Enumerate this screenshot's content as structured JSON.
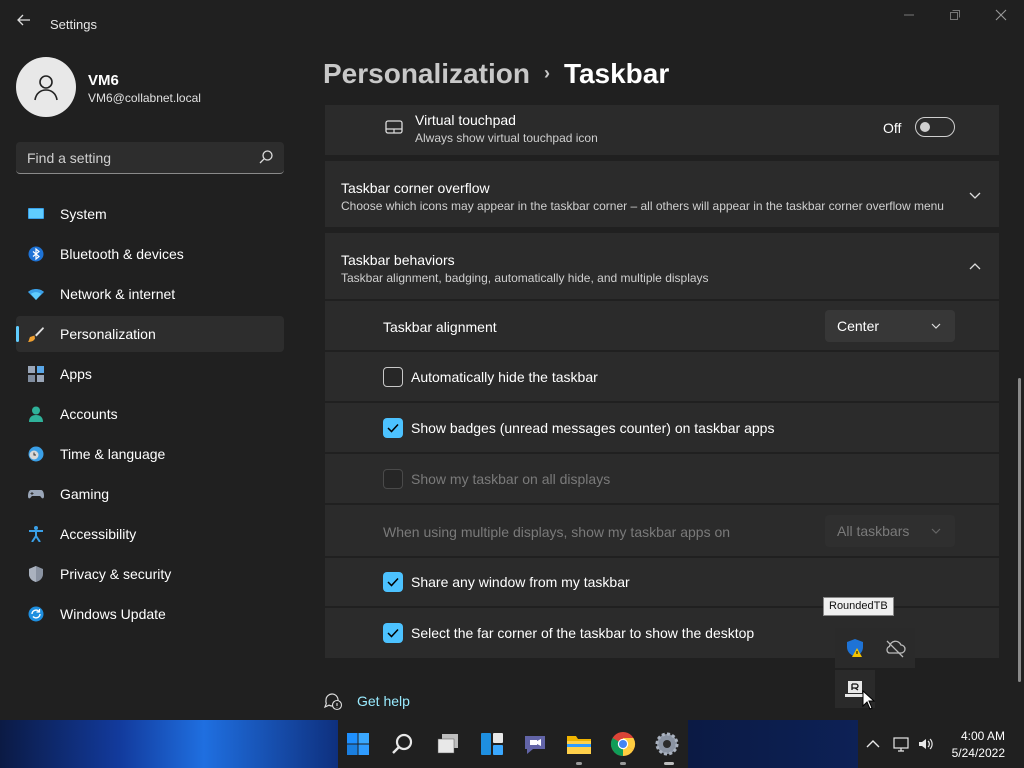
{
  "window": {
    "title": "Settings",
    "back_icon": "back-arrow-icon",
    "controls": [
      "minimize-icon",
      "maximize-icon",
      "close-icon"
    ]
  },
  "user": {
    "name": "VM6",
    "email": "VM6@collabnet.local"
  },
  "search": {
    "placeholder": "Find a setting",
    "value": ""
  },
  "sidebar": {
    "items": [
      {
        "label": "System",
        "icon": "monitor-icon"
      },
      {
        "label": "Bluetooth & devices",
        "icon": "bluetooth-icon"
      },
      {
        "label": "Network & internet",
        "icon": "wifi-icon"
      },
      {
        "label": "Personalization",
        "icon": "paintbrush-icon",
        "selected": true
      },
      {
        "label": "Apps",
        "icon": "apps-icon"
      },
      {
        "label": "Accounts",
        "icon": "person-icon"
      },
      {
        "label": "Time & language",
        "icon": "clock-globe-icon"
      },
      {
        "label": "Gaming",
        "icon": "gamepad-icon"
      },
      {
        "label": "Accessibility",
        "icon": "accessibility-icon"
      },
      {
        "label": "Privacy & security",
        "icon": "shield-icon"
      },
      {
        "label": "Windows Update",
        "icon": "update-icon"
      }
    ]
  },
  "breadcrumb": {
    "parent": "Personalization",
    "separator": "›",
    "current": "Taskbar"
  },
  "content": {
    "touchpad": {
      "title": "Virtual touchpad",
      "desc": "Always show virtual touchpad icon",
      "state": "Off",
      "on": false
    },
    "corner_overflow": {
      "title": "Taskbar corner overflow",
      "desc": "Choose which icons may appear in the taskbar corner – all others will appear in the taskbar corner overflow menu",
      "expanded": false
    },
    "behaviors": {
      "title": "Taskbar behaviors",
      "desc": "Taskbar alignment, badging, automatically hide, and multiple displays",
      "expanded": true,
      "alignment_label": "Taskbar alignment",
      "alignment_value": "Center",
      "auto_hide": {
        "label": "Automatically hide the taskbar",
        "checked": false
      },
      "badges": {
        "label": "Show badges (unread messages counter) on taskbar apps",
        "checked": true
      },
      "all_displays": {
        "label": "Show my taskbar on all displays",
        "checked": false,
        "disabled": true
      },
      "multi_label": "When using multiple displays, show my taskbar apps on",
      "multi_value": "All taskbars",
      "share_window": {
        "label": "Share any window from my taskbar",
        "checked": true
      },
      "far_corner": {
        "label": "Select the far corner of the taskbar to show the desktop",
        "checked": true
      }
    }
  },
  "get_help": "Get help",
  "tooltip": "RoundedTB",
  "tray_flyout_icons": [
    "shield-warning-icon",
    "cloud-off-icon",
    "roundedtb-icon"
  ],
  "taskbar": {
    "apps": [
      "windows-start-icon",
      "search-icon",
      "task-view-icon",
      "widgets-icon",
      "teams-chat-icon",
      "file-explorer-icon",
      "chrome-icon",
      "settings-gear-icon"
    ],
    "tray_icons": [
      "chevron-up-icon",
      "network-icon",
      "volume-icon"
    ],
    "time": "4:00 AM",
    "date": "5/24/2022"
  },
  "colors": {
    "accent": "#4cc2ff",
    "background": "#202020",
    "card": "#2b2b2b",
    "link": "#99ebff"
  }
}
